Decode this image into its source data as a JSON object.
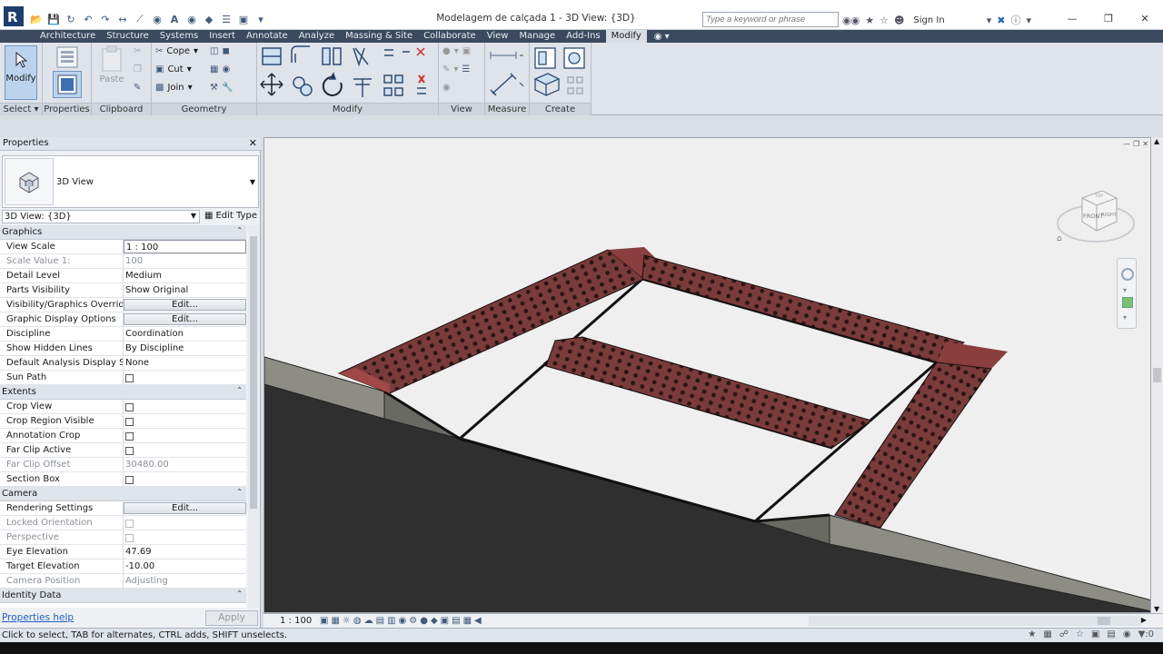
{
  "titlebar": {
    "title": "Modelagem de calçada 1 - 3D View: {3D}",
    "search_placeholder": "Type a keyword or phrase",
    "signin": "Sign In"
  },
  "tabs": [
    "Architecture",
    "Structure",
    "Systems",
    "Insert",
    "Annotate",
    "Analyze",
    "Massing & Site",
    "Collaborate",
    "View",
    "Manage",
    "Add-Ins",
    "Modify"
  ],
  "active_tab": "Modify",
  "ribbon": {
    "modify": "Modify",
    "select": "Select",
    "properties": "Properties",
    "clipboard": "Clipboard",
    "paste": "Paste",
    "geometry": "Geometry",
    "cope": "Cope",
    "cut": "Cut",
    "join": "Join",
    "modify_panel": "Modify",
    "view": "View",
    "measure": "Measure",
    "create": "Create"
  },
  "properties": {
    "header": "Properties",
    "type_name": "3D View",
    "view_selector": "3D View: {3D}",
    "edit_type": "Edit Type",
    "help": "Properties help",
    "apply": "Apply",
    "groups": {
      "graphics": "Graphics",
      "extents": "Extents",
      "camera": "Camera",
      "identity": "Identity Data"
    },
    "rows": {
      "view_scale": {
        "name": "View Scale",
        "value": "1 : 100"
      },
      "scale_value": {
        "name": "Scale Value    1:",
        "value": "100"
      },
      "detail_level": {
        "name": "Detail Level",
        "value": "Medium"
      },
      "parts_visibility": {
        "name": "Parts Visibility",
        "value": "Show Original"
      },
      "vg_overrides": {
        "name": "Visibility/Graphics Overrides",
        "value": "Edit..."
      },
      "graphic_display": {
        "name": "Graphic Display Options",
        "value": "Edit..."
      },
      "discipline": {
        "name": "Discipline",
        "value": "Coordination"
      },
      "hidden_lines": {
        "name": "Show Hidden Lines",
        "value": "By Discipline"
      },
      "analysis_display": {
        "name": "Default Analysis Display St...",
        "value": "None"
      },
      "sun_path": {
        "name": "Sun Path"
      },
      "crop_view": {
        "name": "Crop View"
      },
      "crop_region": {
        "name": "Crop Region Visible"
      },
      "annotation_crop": {
        "name": "Annotation Crop"
      },
      "far_clip_active": {
        "name": "Far Clip Active"
      },
      "far_clip_offset": {
        "name": "Far Clip Offset",
        "value": "30480.00"
      },
      "section_box": {
        "name": "Section Box"
      },
      "rendering": {
        "name": "Rendering Settings",
        "value": "Edit..."
      },
      "locked_orientation": {
        "name": "Locked Orientation"
      },
      "perspective": {
        "name": "Perspective"
      },
      "eye_elevation": {
        "name": "Eye Elevation",
        "value": "47.69"
      },
      "target_elevation": {
        "name": "Target Elevation",
        "value": "-10.00"
      },
      "camera_position": {
        "name": "Camera Position",
        "value": "Adjusting"
      }
    }
  },
  "viewcube": {
    "front": "FRONT",
    "right": "RIGHT",
    "top": "TOP"
  },
  "view_bar": {
    "scale": "1 : 100"
  },
  "status": {
    "text": "Click to select, TAB for alternates, CTRL adds, SHIFT unselects."
  },
  "colors": {
    "tactile": "#7a3b3b",
    "tactile_dark": "#a04848",
    "road": "#2f2f2f",
    "curb": "#8d8d86",
    "sidewalk": "#eeeeee"
  }
}
